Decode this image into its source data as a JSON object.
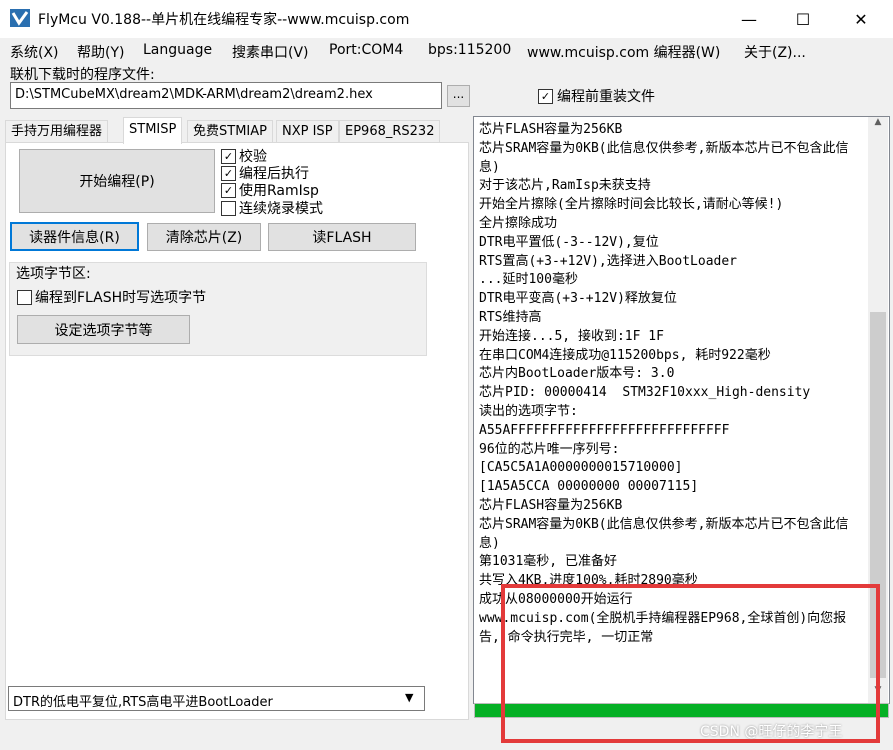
{
  "window": {
    "title": "FlyMcu V0.188--单片机在线编程专家--www.mcuisp.com",
    "minimize_glyph": "—",
    "maximize_glyph": "☐",
    "close_glyph": "✕"
  },
  "menu": [
    "系统(X)",
    "帮助(Y)",
    "Language",
    "搜素串口(V)",
    "Port:COM4",
    "bps:115200",
    "www.mcuisp.com 编程器(W)",
    "关于(Z)..."
  ],
  "file": {
    "label": "联机下载时的程序文件:",
    "path": "D:\\STMCubeMX\\dream2\\MDK-ARM\\dream2\\dream2.hex",
    "browse_label": "...",
    "reload_label": "编程前重装文件",
    "reload_checked": "✓"
  },
  "tabs": [
    "手持万用编程器",
    "STMISP",
    "免费STMIAP",
    "NXP ISP",
    "EP968_RS232"
  ],
  "stmisp": {
    "start_button": "开始编程(P)",
    "options": [
      {
        "label": "校验",
        "mark": "✓"
      },
      {
        "label": "编程后执行",
        "mark": "✓"
      },
      {
        "label": "使用RamIsp",
        "mark": "✓"
      },
      {
        "label": "连续烧录模式",
        "mark": ""
      }
    ],
    "read_info_button": "读器件信息(R)",
    "erase_button": "清除芯片(Z)",
    "read_flash_button": "读FLASH",
    "option_group_label": "选项字节区:",
    "write_option_label": "编程到FLASH时写选项字节",
    "write_option_mark": "",
    "set_option_button": "设定选项字节等"
  },
  "mode_select": "DTR的低电平复位,RTS高电平进BootLoader",
  "log_lines": [
    "芯片FLASH容量为256KB",
    "芯片SRAM容量为0KB(此信息仅供参考,新版本芯片已不包含此信息)",
    "对于该芯片,RamIsp未获支持",
    "开始全片擦除(全片擦除时间会比较长,请耐心等候!)",
    "全片擦除成功",
    "DTR电平置低(-3--12V),复位",
    "RTS置高(+3-+12V),选择进入BootLoader",
    "...延时100毫秒",
    "DTR电平变高(+3-+12V)释放复位",
    "RTS维持高",
    "开始连接...5, 接收到:1F 1F",
    "在串口COM4连接成功@115200bps, 耗时922毫秒",
    "芯片内BootLoader版本号: 3.0",
    "芯片PID: 00000414  STM32F10xxx_High-density",
    "读出的选项字节:",
    "A55AFFFFFFFFFFFFFFFFFFFFFFFFFFFF",
    "96位的芯片唯一序列号:",
    "[CA5C5A1A0000000015710000]",
    "[1A5A5CCA 00000000 00007115]",
    "芯片FLASH容量为256KB",
    "芯片SRAM容量为0KB(此信息仅供参考,新版本芯片已不包含此信息)",
    "第1031毫秒, 已准备好",
    "共写入4KB,进度100%,耗时2890毫秒",
    "成功从08000000开始运行",
    "www.mcuisp.com(全脱机手持编程器EP968,全球首创)向您报告, 命令执行完毕, 一切正常"
  ],
  "progress_fraction": 1.0,
  "watermark": "CSDN @旺仔的李宁王",
  "colors": {
    "progress": "#06b025",
    "highlight_box": "#e33a3a",
    "focus": "#0078d7"
  }
}
